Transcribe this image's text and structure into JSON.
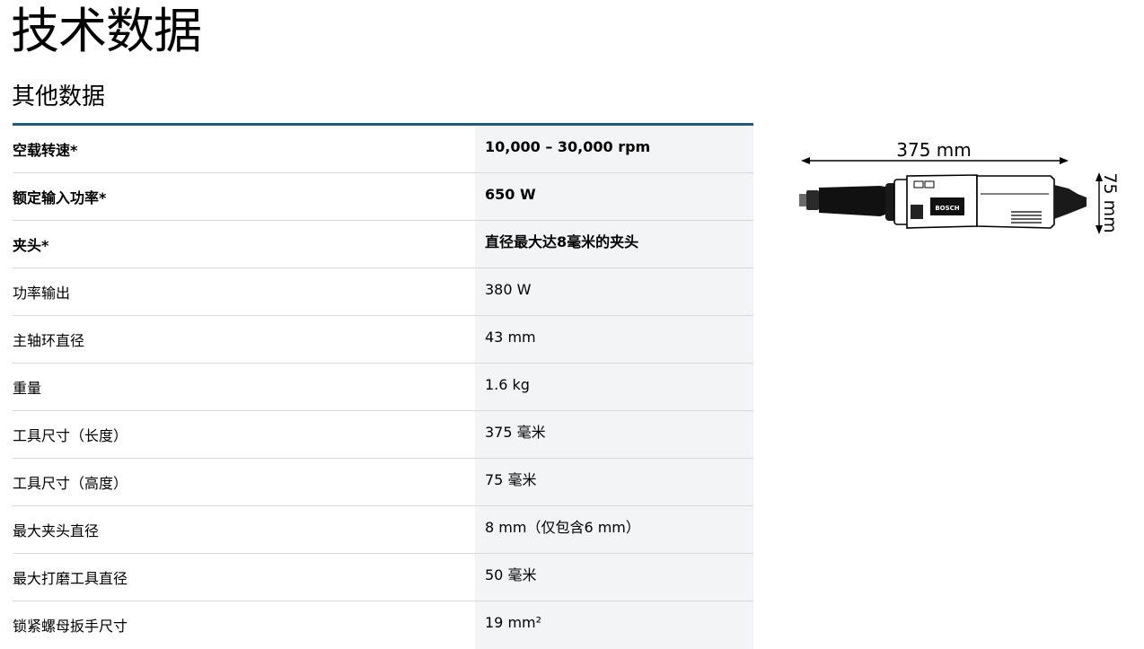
{
  "page": {
    "title": "技术数据",
    "section_title": "其他数据"
  },
  "specs": [
    {
      "label": "空载转速*",
      "value": "10,000 – 30,000 rpm",
      "emphasis": true
    },
    {
      "label": "额定输入功率*",
      "value": "650 W",
      "emphasis": true
    },
    {
      "label": "夹头*",
      "value": "直径最大达8毫米的夹头",
      "emphasis": true
    },
    {
      "label": "功率输出",
      "value": "380 W",
      "emphasis": false
    },
    {
      "label": "主轴环直径",
      "value": "43 mm",
      "emphasis": false
    },
    {
      "label": "重量",
      "value": "1.6 kg",
      "emphasis": false
    },
    {
      "label": "工具尺寸（长度）",
      "value": "375 毫米",
      "emphasis": false
    },
    {
      "label": "工具尺寸（高度）",
      "value": "75 毫米",
      "emphasis": false
    },
    {
      "label": "最大夹头直径",
      "value": "8 mm（仅包含6 mm）",
      "emphasis": false
    },
    {
      "label": "最大打磨工具直径",
      "value": "50 毫米",
      "emphasis": false
    },
    {
      "label": "锁紧螺母扳手尺寸",
      "value": "19 mm²",
      "emphasis": false
    }
  ],
  "diagram": {
    "length_label": "375 mm",
    "height_label": "75 mm",
    "brand_text": "BOSCH",
    "icon": "die-grinder-dimension-drawing"
  },
  "colors": {
    "table_top_rule": "#1e5a7a",
    "value_column_bg": "#f3f4f5",
    "row_divider": "#d9d9d9"
  }
}
